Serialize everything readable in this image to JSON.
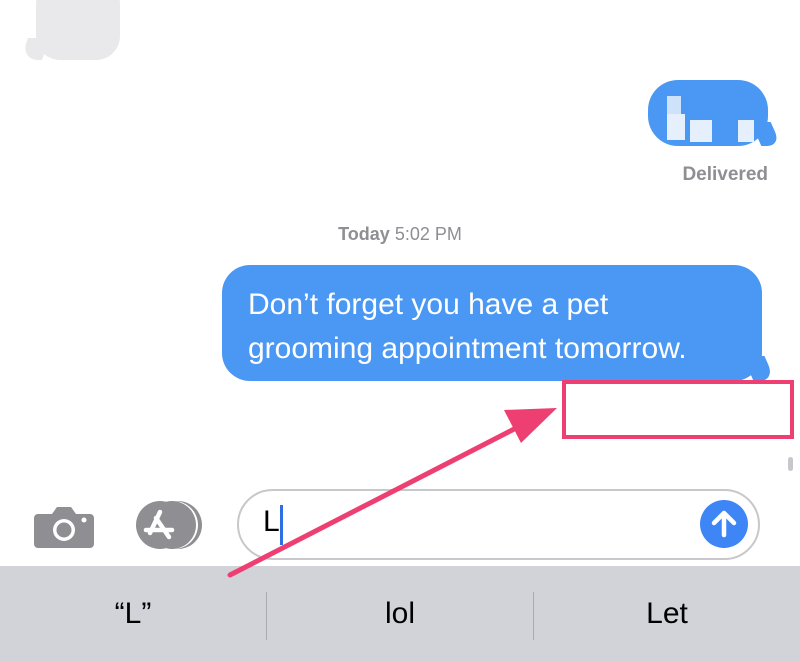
{
  "conversation": {
    "status_label": "Delivered",
    "timestamp_day": "Today",
    "timestamp_time": "5:02 PM",
    "sent_message_line1": "Don’t forget you have a pet",
    "sent_message_line2": "grooming appointment tomorrow."
  },
  "input_bar": {
    "camera_icon": "camera-icon",
    "apps_icon": "app-store-icon",
    "message_value": "L",
    "send_icon": "arrow-up-icon"
  },
  "keyboard": {
    "suggestions": [
      "“L”",
      "lol",
      "Let"
    ]
  },
  "annotation": {
    "color": "#ee3f73"
  },
  "colors": {
    "imessage_blue": "#4a98f3",
    "received_gray": "#e9e9eb",
    "keyboard_gray": "#d1d3d9"
  }
}
